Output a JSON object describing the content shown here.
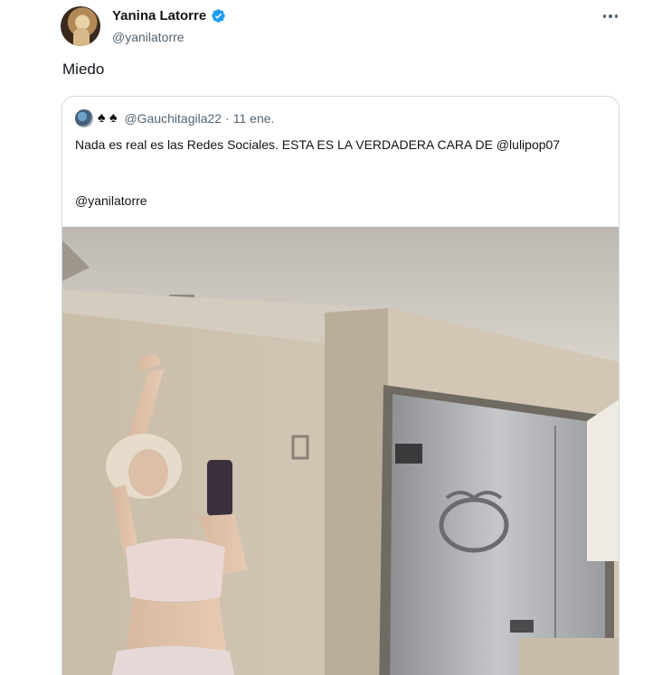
{
  "tweet": {
    "author_name": "Yanina Latorre",
    "author_handle": "@yanilatorre",
    "text": "Miedo",
    "verified": true
  },
  "quote": {
    "handle": "@Gauchitagila22",
    "separator": "·",
    "date": "11 ene.",
    "name_glyphs": "♠ ♠",
    "text": "Nada es real es las Redes Sociales. ESTA ES LA VERDADERA CARA DE @lulipop07",
    "mention": "@yanilatorre"
  },
  "icons": {
    "verified": "verified-badge-icon",
    "more": "more-options-icon"
  },
  "colors": {
    "verified_blue": "#1d9bf0",
    "secondary_text": "#536471",
    "border": "#cfd9de"
  }
}
